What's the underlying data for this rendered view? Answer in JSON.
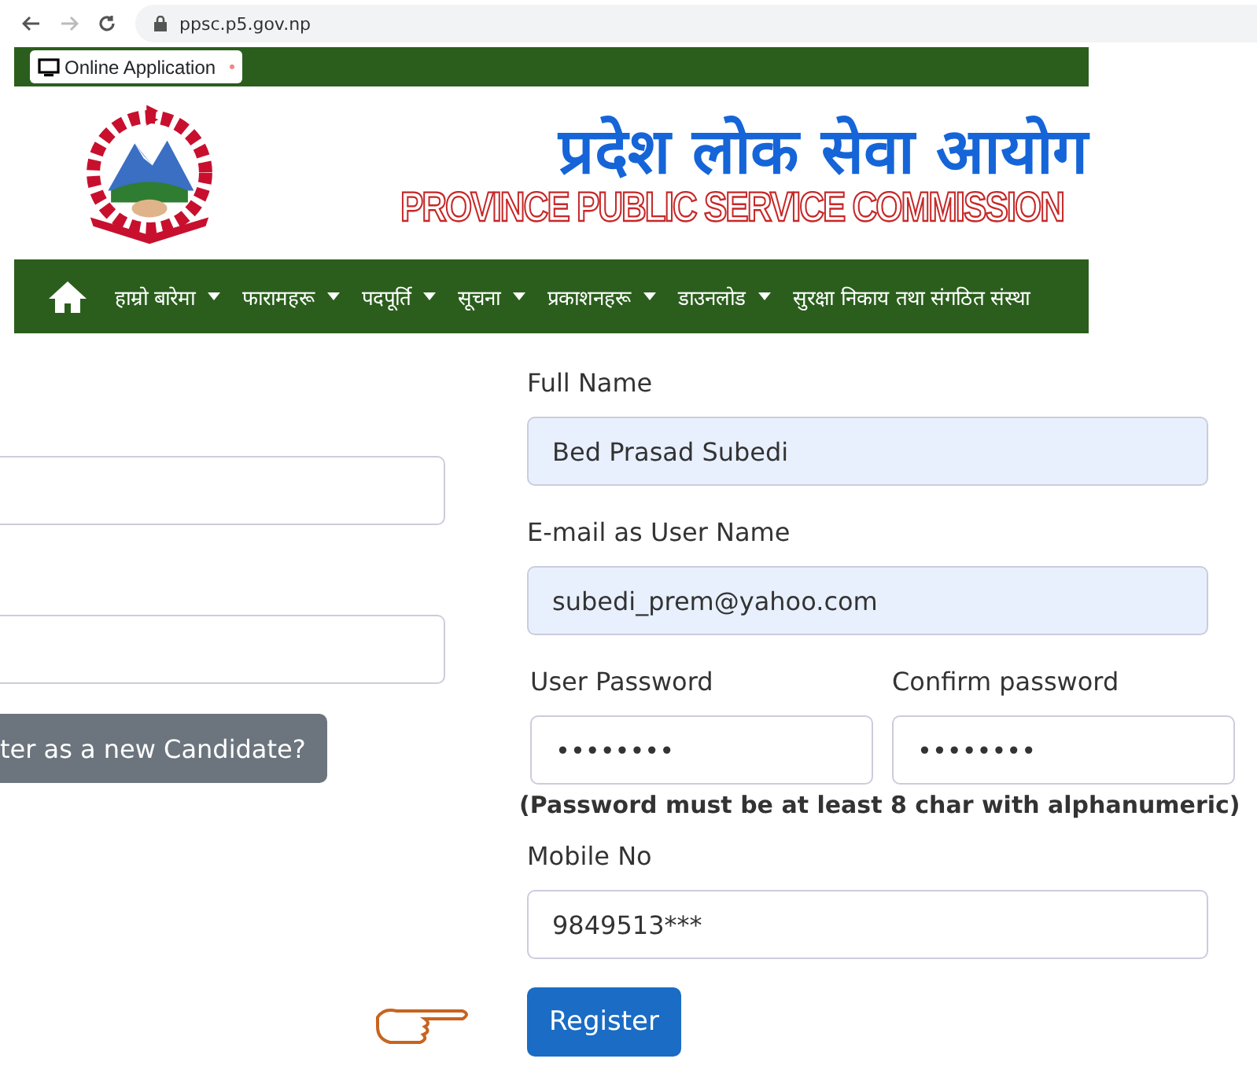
{
  "browser": {
    "url": "ppsc.p5.gov.np"
  },
  "tab": {
    "label": "Online Application"
  },
  "header": {
    "title_np": "प्रदेश लोक सेवा आयोग",
    "title_en": "PROVINCE PUBLIC SERVICE COMMISSION"
  },
  "nav": {
    "items": [
      {
        "label": "हाम्रो बारेमा",
        "dropdown": true
      },
      {
        "label": "फारामहरू",
        "dropdown": true
      },
      {
        "label": "पदपूर्ति",
        "dropdown": true
      },
      {
        "label": "सूचना",
        "dropdown": true
      },
      {
        "label": "प्रकाशनहरू",
        "dropdown": true
      },
      {
        "label": "डाउनलोड",
        "dropdown": true
      },
      {
        "label": "सुरक्षा निकाय तथा संगठित संस्था",
        "dropdown": false
      }
    ]
  },
  "login": {
    "button": "ter as a new Candidate?"
  },
  "register": {
    "full_name": {
      "label": "Full Name",
      "value": "Bed Prasad Subedi"
    },
    "email": {
      "label": "E-mail as User Name",
      "value": "subedi_prem@yahoo.com"
    },
    "password": {
      "label": "User Password",
      "value": "••••••••"
    },
    "confirm": {
      "label": "Confirm password",
      "value": "••••••••"
    },
    "note": "(Password must be at least 8 char with alphanumeric)",
    "mobile": {
      "label": "Mobile No",
      "value": "9849513***"
    },
    "button": "Register"
  }
}
